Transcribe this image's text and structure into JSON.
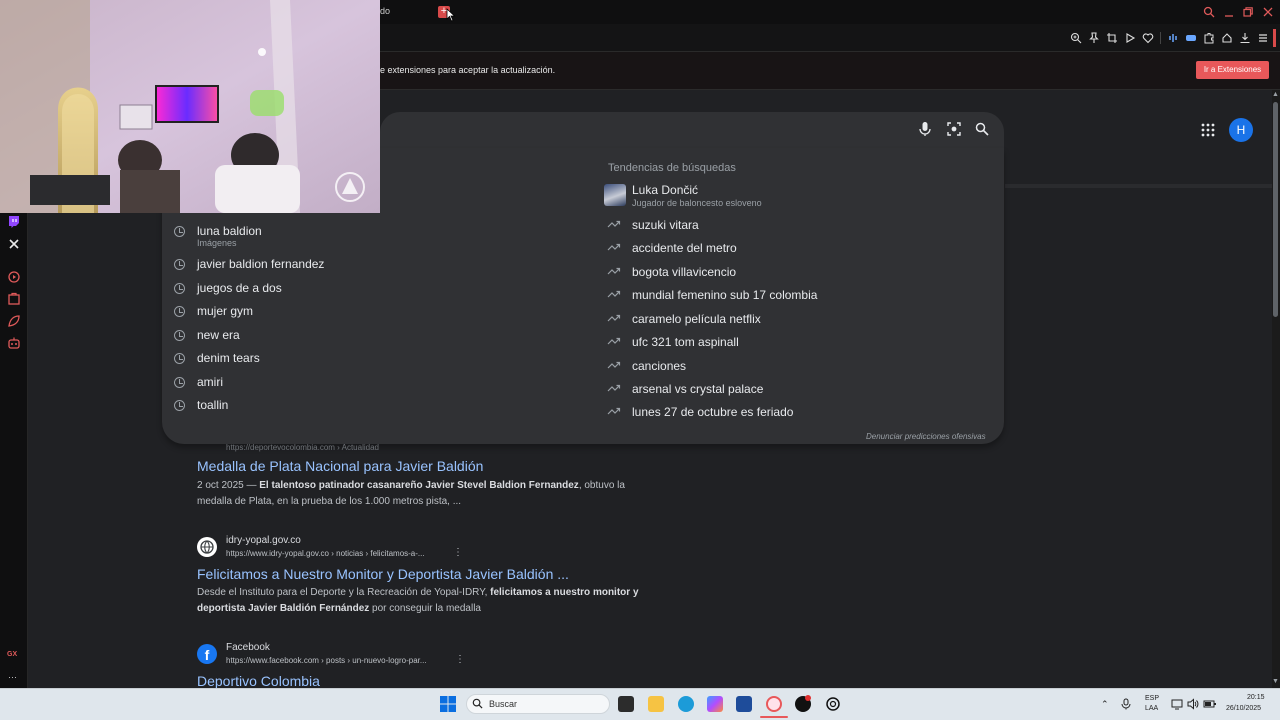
{
  "tab": {
    "partial_title": "do",
    "new_tab_icon": "plus-icon"
  },
  "window_controls": [
    "search-icon",
    "minimize-icon",
    "restore-icon",
    "close-icon"
  ],
  "toolbar_icons": [
    "zoom-icon",
    "pin-icon",
    "screenshot-icon",
    "play-icon",
    "heart-icon",
    "audio-icon",
    "extension-icon",
    "puzzle-icon",
    "wallet-icon",
    "download-icon",
    "menu-icon"
  ],
  "infobar": {
    "message": "e extensiones para aceptar la actualización.",
    "button": "Ir a Extensiones",
    "accent": "#e8585a"
  },
  "sidebar_icons": [
    "twitch-icon",
    "x-icon",
    "player-icon",
    "bag-icon",
    "leaf-icon",
    "robot-icon",
    "gx-icon",
    "more-icon"
  ],
  "sidebar_labels": {
    "gx": "GX",
    "more": "···"
  },
  "search": {
    "avatar_letter": "H",
    "avatar_color": "#1a73e8"
  },
  "history": [
    {
      "text": "luna baldion",
      "sub": "Imágenes"
    },
    {
      "text": "javier baldion fernandez"
    },
    {
      "text": "juegos de a dos"
    },
    {
      "text": "mujer gym"
    },
    {
      "text": "new era"
    },
    {
      "text": "denim tears"
    },
    {
      "text": "amiri"
    },
    {
      "text": "toallin"
    }
  ],
  "trends": {
    "heading": "Tendencias de búsquedas",
    "featured": {
      "title": "Luka Dončić",
      "subtitle": "Jugador de baloncesto esloveno"
    },
    "items": [
      "suzuki vitara",
      "accidente del metro",
      "bogota villavicencio",
      "mundial femenino sub 17 colombia",
      "caramelo película netflix",
      "ufc 321 tom aspinall",
      "canciones",
      "arsenal vs crystal palace",
      "lunes 27 de octubre es feriado"
    ],
    "report": "Denunciar predicciones ofensivas"
  },
  "results": [
    {
      "url": "https://deportevocolombia.com › Actualidad",
      "title": "Medalla de Plata Nacional para Javier Baldión",
      "snippet_date": "2 oct 2025 — ",
      "snippet_bold": "El talentoso patinador casanareño Javier Stevel Baldion Fernandez",
      "snippet_rest": ", obtuvo la medalla de Plata, en la prueba de los 1.000 metros pista, ..."
    },
    {
      "site": "idry-yopal.gov.co",
      "url": "https://www.idry-yopal.gov.co › noticias › felicitamos-a-...",
      "title": "Felicitamos a Nuestro Monitor y Deportista Javier Baldión ...",
      "snippet_pre": "Desde el Instituto para el Deporte y la Recreación de Yopal-IDRY, ",
      "snippet_bold": "felicitamos a nuestro monitor y deportista Javier Baldión Fernández",
      "snippet_rest": " por conseguir la medalla"
    },
    {
      "site": "Facebook",
      "url": "https://www.facebook.com › posts › un-nuevo-logro-par...",
      "title": "Deportivo Colombia"
    }
  ],
  "taskbar": {
    "search_placeholder": "Buscar",
    "lang_top": "ESP",
    "lang_bottom": "LAA",
    "time": "20:15",
    "date": "26/10/2025"
  }
}
